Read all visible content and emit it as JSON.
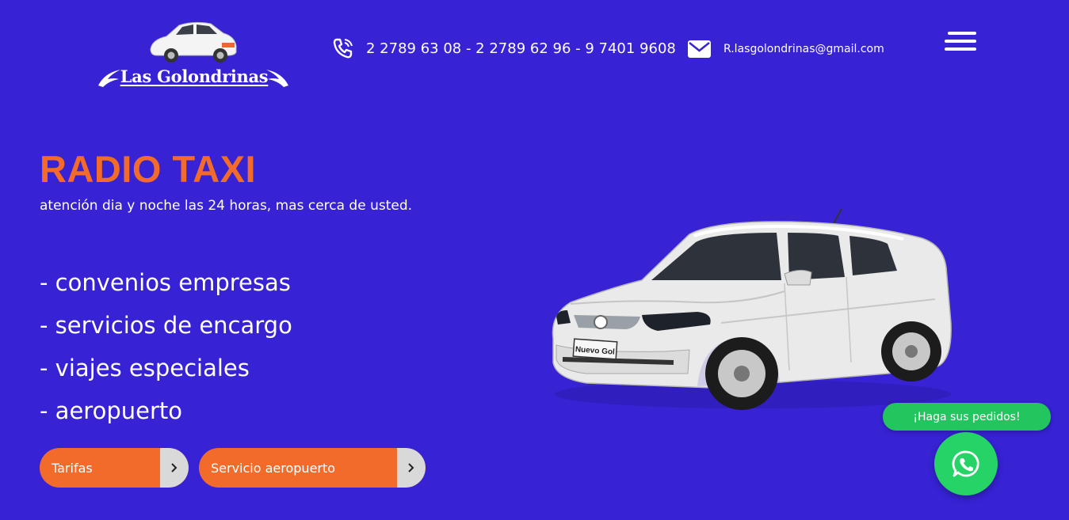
{
  "brand": {
    "name": "Las Golondrinas"
  },
  "header": {
    "phones": "2 2789 63 08 - 2 2789 62 96 - 9 7401 9608",
    "email": "R.lasgolondrinas@gmail.com",
    "menu_icon": "hamburger-icon",
    "phone_icon": "phone-ringing-icon",
    "email_icon": "envelope-icon"
  },
  "hero": {
    "title": "RADIO TAXI",
    "subtitle": "atención dia y noche las 24 horas, mas cerca de usted.",
    "services": [
      "- convenios empresas",
      "- servicios de encargo",
      "- viajes especiales",
      "- aeropuerto"
    ],
    "buttons": {
      "tarifas": "Tarifas",
      "aeropuerto": "Servicio aeropuerto"
    }
  },
  "car_plate": "Nuevo Gol",
  "whatsapp": {
    "label": "¡Haga sus pedidos!",
    "icon": "whatsapp-icon"
  },
  "colors": {
    "background": "#3722d4",
    "accent": "#f26b2b",
    "whatsapp": "#25d366"
  }
}
